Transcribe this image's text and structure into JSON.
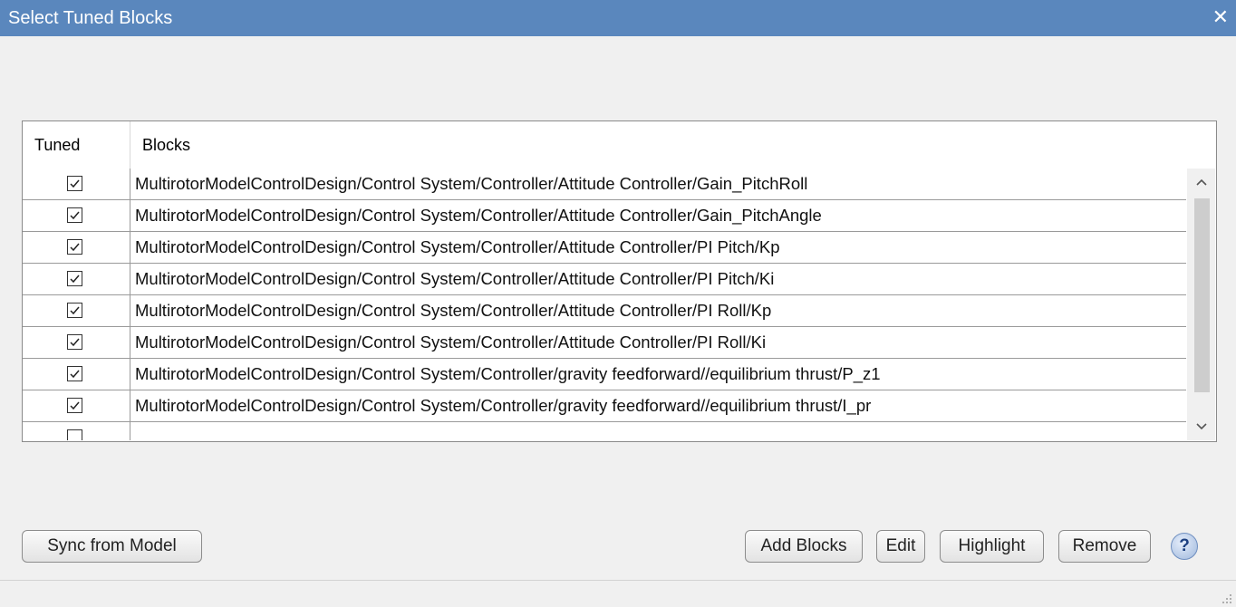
{
  "window": {
    "title": "Select Tuned Blocks",
    "close_glyph": "✕"
  },
  "table": {
    "columns": [
      "Tuned",
      "Blocks"
    ],
    "rows": [
      {
        "tuned": true,
        "block": "MultirotorModelControlDesign/Control System/Controller/Attitude Controller/Gain_PitchRoll"
      },
      {
        "tuned": true,
        "block": "MultirotorModelControlDesign/Control System/Controller/Attitude Controller/Gain_PitchAngle"
      },
      {
        "tuned": true,
        "block": "MultirotorModelControlDesign/Control System/Controller/Attitude Controller/PI Pitch/Kp"
      },
      {
        "tuned": true,
        "block": "MultirotorModelControlDesign/Control System/Controller/Attitude Controller/PI Pitch/Ki"
      },
      {
        "tuned": true,
        "block": "MultirotorModelControlDesign/Control System/Controller/Attitude Controller/PI Roll/Kp"
      },
      {
        "tuned": true,
        "block": "MultirotorModelControlDesign/Control System/Controller/Attitude Controller/PI Roll/Ki"
      },
      {
        "tuned": true,
        "block": "MultirotorModelControlDesign/Control System/Controller/gravity feedforward//equilibrium thrust/P_z1"
      },
      {
        "tuned": true,
        "block": "MultirotorModelControlDesign/Control System/Controller/gravity feedforward//equilibrium thrust/I_pr"
      }
    ]
  },
  "buttons": {
    "sync": "Sync from Model",
    "add": "Add Blocks",
    "edit": "Edit",
    "highlight": "Highlight",
    "remove": "Remove",
    "help": "?"
  },
  "icons": {
    "close": "close-icon",
    "help": "help-icon",
    "scroll_up": "chevron-up-icon",
    "scroll_down": "chevron-down-icon",
    "check": "check-icon"
  },
  "colors": {
    "titlebar": "#5a87bd",
    "background": "#f0f0f0"
  }
}
